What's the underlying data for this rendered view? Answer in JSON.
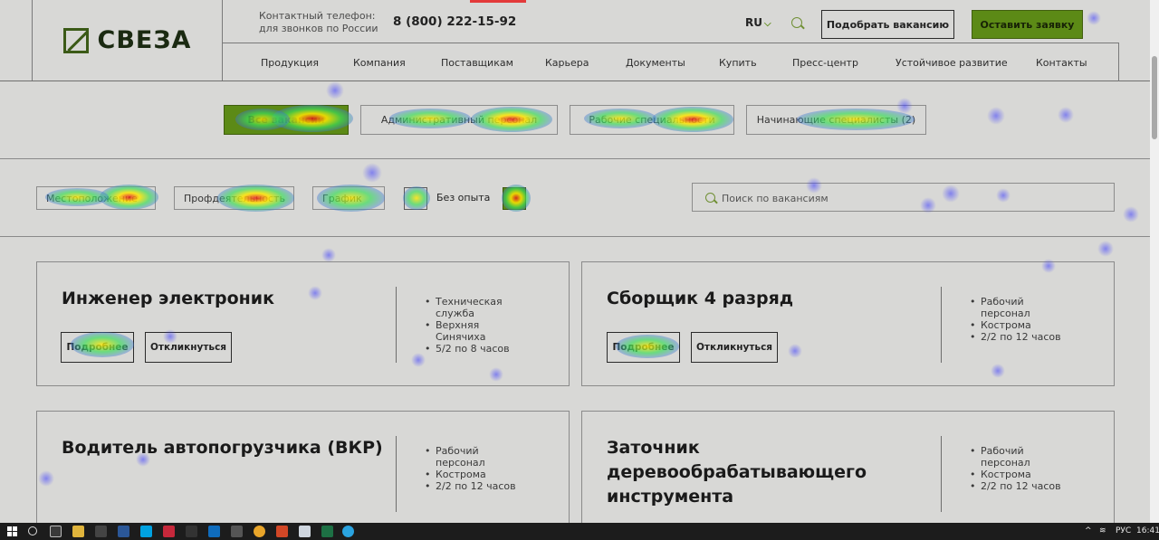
{
  "header": {
    "logo_text": "СВЕЗА",
    "contact_label": "Контактный телефон: для звонков по России",
    "phone": "8 (800) 222-15-92",
    "language": "RU",
    "find_vacancy_button": "Подобрать вакансию",
    "leave_request_button": "Оставить заявку",
    "nav": [
      "Продукция",
      "Компания",
      "Поставщикам",
      "Карьера",
      "Документы",
      "Купить",
      "Пресс-центр",
      "Устойчивое развитие",
      "Контакты"
    ],
    "accent_color": "#5c8a16"
  },
  "tabs": [
    {
      "label": "Все вакансии"
    },
    {
      "label": "Административный персонал"
    },
    {
      "label": "Рабочие специальности"
    },
    {
      "label": "Начинающие специалисты (2)"
    }
  ],
  "filters": {
    "location": "Местоположение",
    "profession": "Профдеятельность",
    "schedule": "График",
    "no_experience_label": "Без опыта",
    "search_placeholder": "Поиск по вакансиям"
  },
  "vacancies": [
    {
      "title": "Инженер электроник",
      "details": [
        "Техническая служба",
        "Верхняя Синячиха",
        "5/2 по 8 часов"
      ],
      "more_button": "Подробнее",
      "apply_button": "Откликнуться"
    },
    {
      "title": "Сборщик 4 разряд",
      "details": [
        "Рабочий персонал",
        "Кострома",
        "2/2 по 12 часов"
      ],
      "more_button": "Подробнее",
      "apply_button": "Откликнуться"
    },
    {
      "title": "Водитель автопогрузчика (ВКР)",
      "details": [
        "Рабочий персонал",
        "Кострома",
        "2/2 по 12 часов"
      ]
    },
    {
      "title": "Заточник деревообрабатывающего инструмента",
      "details": [
        "Рабочий персонал",
        "Кострома",
        "2/2 по 12 часов"
      ]
    }
  ],
  "taskbar": {
    "language": "РУС",
    "time": "16:41"
  }
}
